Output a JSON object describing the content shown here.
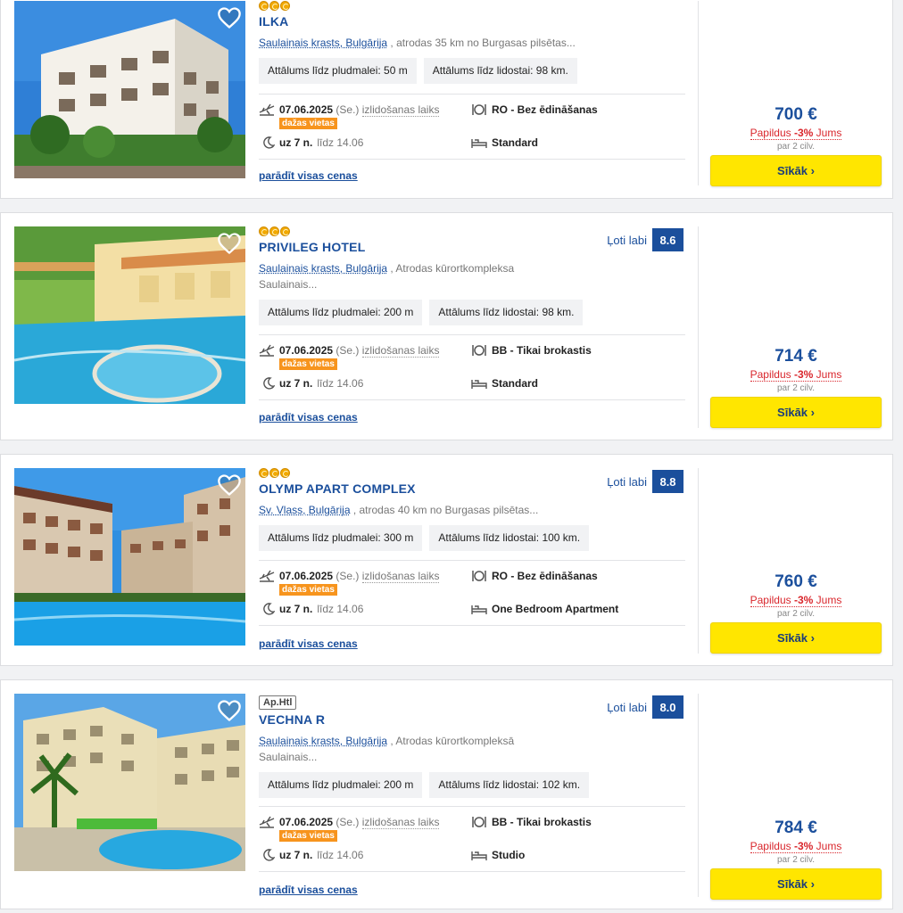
{
  "hotels": [
    {
      "name": "ILKA",
      "type_badge": "",
      "stars": 3,
      "location_link": "Saulainais krasts, Bulgārija",
      "location_rest": " , atrodas 35 km no Burgasas pilsētas...",
      "location_rest2": "",
      "rating_label": "",
      "rating_score": "",
      "beach_distance": "Attālums līdz pludmalei: 50 m",
      "airport_distance": "Attālums līdz lidostai: 98 km.",
      "date": "07.06.2025",
      "weekday": "(Se.)",
      "departure_label": "izlidošanas laiks",
      "seats_tag": "dažas vietas",
      "nights": "uz 7 n.",
      "until": "līdz 14.06",
      "board": "RO - Bez ēdināšanas",
      "room": "Standard",
      "all_prices": "parādīt visas cenas",
      "price": "700 €",
      "extra_prefix": "Papildus ",
      "extra_discount": "-3%",
      "extra_suffix": " Jums",
      "per_persons": "par 2 cilv.",
      "button": "Sīkāk ›"
    },
    {
      "name": "PRIVILEG HOTEL",
      "type_badge": "",
      "stars": 3,
      "location_link": "Saulainais krasts, Bulgārija",
      "location_rest": " , Atrodas kūrortkompleksa",
      "location_rest2": "Saulainais...",
      "rating_label": "Ļoti labi",
      "rating_score": "8.6",
      "beach_distance": "Attālums līdz pludmalei: 200 m",
      "airport_distance": "Attālums līdz lidostai: 98 km.",
      "date": "07.06.2025",
      "weekday": "(Se.)",
      "departure_label": "izlidošanas laiks",
      "seats_tag": "dažas vietas",
      "nights": "uz 7 n.",
      "until": "līdz 14.06",
      "board": "BB - Tikai brokastis",
      "room": "Standard",
      "all_prices": "parādīt visas cenas",
      "price": "714 €",
      "extra_prefix": "Papildus ",
      "extra_discount": "-3%",
      "extra_suffix": " Jums",
      "per_persons": "par 2 cilv.",
      "button": "Sīkāk ›"
    },
    {
      "name": "OLYMP APART COMPLEX",
      "type_badge": "",
      "stars": 3,
      "location_link": "Sv. Vlass, Bulgārija",
      "location_rest": " , atrodas 40 km no Burgasas pilsētas...",
      "location_rest2": "",
      "rating_label": "Ļoti labi",
      "rating_score": "8.8",
      "beach_distance": "Attālums līdz pludmalei: 300 m",
      "airport_distance": "Attālums līdz lidostai: 100 km.",
      "date": "07.06.2025",
      "weekday": "(Se.)",
      "departure_label": "izlidošanas laiks",
      "seats_tag": "dažas vietas",
      "nights": "uz 7 n.",
      "until": "līdz 14.06",
      "board": "RO - Bez ēdināšanas",
      "room": "One Bedroom Apartment",
      "all_prices": "parādīt visas cenas",
      "price": "760 €",
      "extra_prefix": "Papildus ",
      "extra_discount": "-3%",
      "extra_suffix": " Jums",
      "per_persons": "par 2 cilv.",
      "button": "Sīkāk ›"
    },
    {
      "name": "VECHNA R",
      "type_badge": "Ap.Htl",
      "stars": 0,
      "location_link": "Saulainais krasts, Bulgārija",
      "location_rest": " , Atrodas kūrortkompleksā",
      "location_rest2": "Saulainais...",
      "rating_label": "Ļoti labi",
      "rating_score": "8.0",
      "beach_distance": "Attālums līdz pludmalei: 200 m",
      "airport_distance": "Attālums līdz lidostai: 102 km.",
      "date": "07.06.2025",
      "weekday": "(Se.)",
      "departure_label": "izlidošanas laiks",
      "seats_tag": "dažas vietas",
      "nights": "uz 7 n.",
      "until": "līdz 14.06",
      "board": "BB - Tikai brokastis",
      "room": "Studio",
      "all_prices": "parādīt visas cenas",
      "price": "784 €",
      "extra_prefix": "Papildus ",
      "extra_discount": "-3%",
      "extra_suffix": " Jums",
      "per_persons": "par 2 cilv.",
      "button": "Sīkāk ›"
    }
  ],
  "icons": {
    "favorite": "heart-icon",
    "plane": "plane-icon",
    "moon": "moon-icon",
    "meal": "meal-icon",
    "bed": "bed-icon"
  },
  "colors": {
    "brand_blue": "#1b4f9c",
    "button_yellow": "#ffe600",
    "seats_orange": "#f7941d",
    "discount_red": "#d9262c"
  }
}
